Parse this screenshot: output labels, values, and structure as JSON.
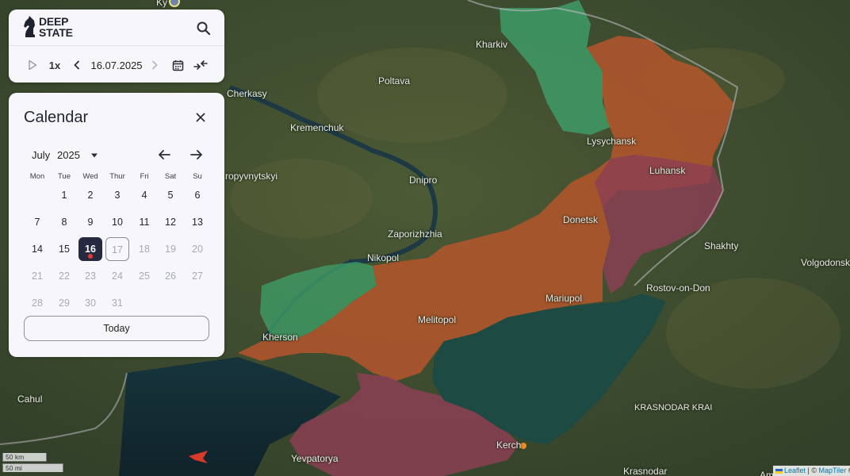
{
  "app": {
    "logo_line1": "DEEP",
    "logo_line2": "STATE"
  },
  "toolbar": {
    "speed": "1x",
    "date": "16.07.2025"
  },
  "calendar": {
    "title": "Calendar",
    "month": "July",
    "year": "2025",
    "weekdays": [
      "Mon",
      "Tue",
      "Wed",
      "Thur",
      "Fri",
      "Sat",
      "Su"
    ],
    "days": [
      "1",
      "2",
      "3",
      "4",
      "5",
      "6",
      "7",
      "8",
      "9",
      "10",
      "11",
      "12",
      "13",
      "14",
      "15",
      "16",
      "17",
      "18",
      "19",
      "20",
      "21",
      "22",
      "23",
      "24",
      "25",
      "26",
      "27",
      "28",
      "29",
      "30",
      "31"
    ],
    "selected_day": "16",
    "today_label": "Today"
  },
  "map": {
    "cities": [
      {
        "name": "Kharkiv"
      },
      {
        "name": "Poltava"
      },
      {
        "name": "Cherkasy"
      },
      {
        "name": "Kremenchuk"
      },
      {
        "name": "Lysychansk"
      },
      {
        "name": "Luhansk"
      },
      {
        "name": "ropyvnytskyi"
      },
      {
        "name": "Dnipro"
      },
      {
        "name": "Donetsk"
      },
      {
        "name": "Shakhty"
      },
      {
        "name": "Zaporizhzhia"
      },
      {
        "name": "Nikopol"
      },
      {
        "name": "Volgodonsk"
      },
      {
        "name": "Rostov-on-Don"
      },
      {
        "name": "Mariupol"
      },
      {
        "name": "Melitopol"
      },
      {
        "name": "Kherson"
      },
      {
        "name": "Cahul"
      },
      {
        "name": "KRASNODAR KRAI"
      },
      {
        "name": "Kerch"
      },
      {
        "name": "Yevpatorya"
      },
      {
        "name": "Krasnodar"
      },
      {
        "name": "Ky"
      },
      {
        "name": "Am"
      }
    ],
    "colors": {
      "occupied": "#b5562c",
      "occupied_pre2022": "#8c3f55",
      "liberated": "#3fa06a",
      "sea": "#15323a",
      "azov": "#1e4a44"
    }
  },
  "scale": {
    "km": "50 km",
    "mi": "50 mi"
  },
  "attribution": {
    "leaflet": "Leaflet",
    "sep": " | © ",
    "maptiler": "MapTiler",
    "tail": " ©"
  }
}
